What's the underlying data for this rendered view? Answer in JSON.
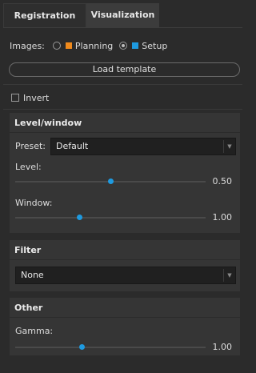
{
  "tabs": [
    {
      "label": "Registration",
      "active": false
    },
    {
      "label": "Visualization",
      "active": true
    }
  ],
  "images": {
    "label": "Images:",
    "options": [
      {
        "label": "Planning",
        "selected": false,
        "color": "#f08a1c"
      },
      {
        "label": "Setup",
        "selected": true,
        "color": "#1e9ae0"
      }
    ]
  },
  "load_template": {
    "label": "Load template"
  },
  "invert": {
    "label": "Invert",
    "checked": false
  },
  "level_window": {
    "title": "Level/window",
    "preset": {
      "label": "Preset:",
      "value": "Default"
    },
    "level": {
      "label": "Level:",
      "value": "0.50",
      "fraction": 0.5
    },
    "window": {
      "label": "Window:",
      "value": "1.00",
      "fraction": 0.34
    }
  },
  "filter": {
    "title": "Filter",
    "value": "None"
  },
  "other": {
    "title": "Other",
    "gamma": {
      "label": "Gamma:",
      "value": "1.00",
      "fraction": 0.35
    }
  },
  "colors": {
    "accent": "#1e9ae0",
    "planning": "#f08a1c"
  }
}
